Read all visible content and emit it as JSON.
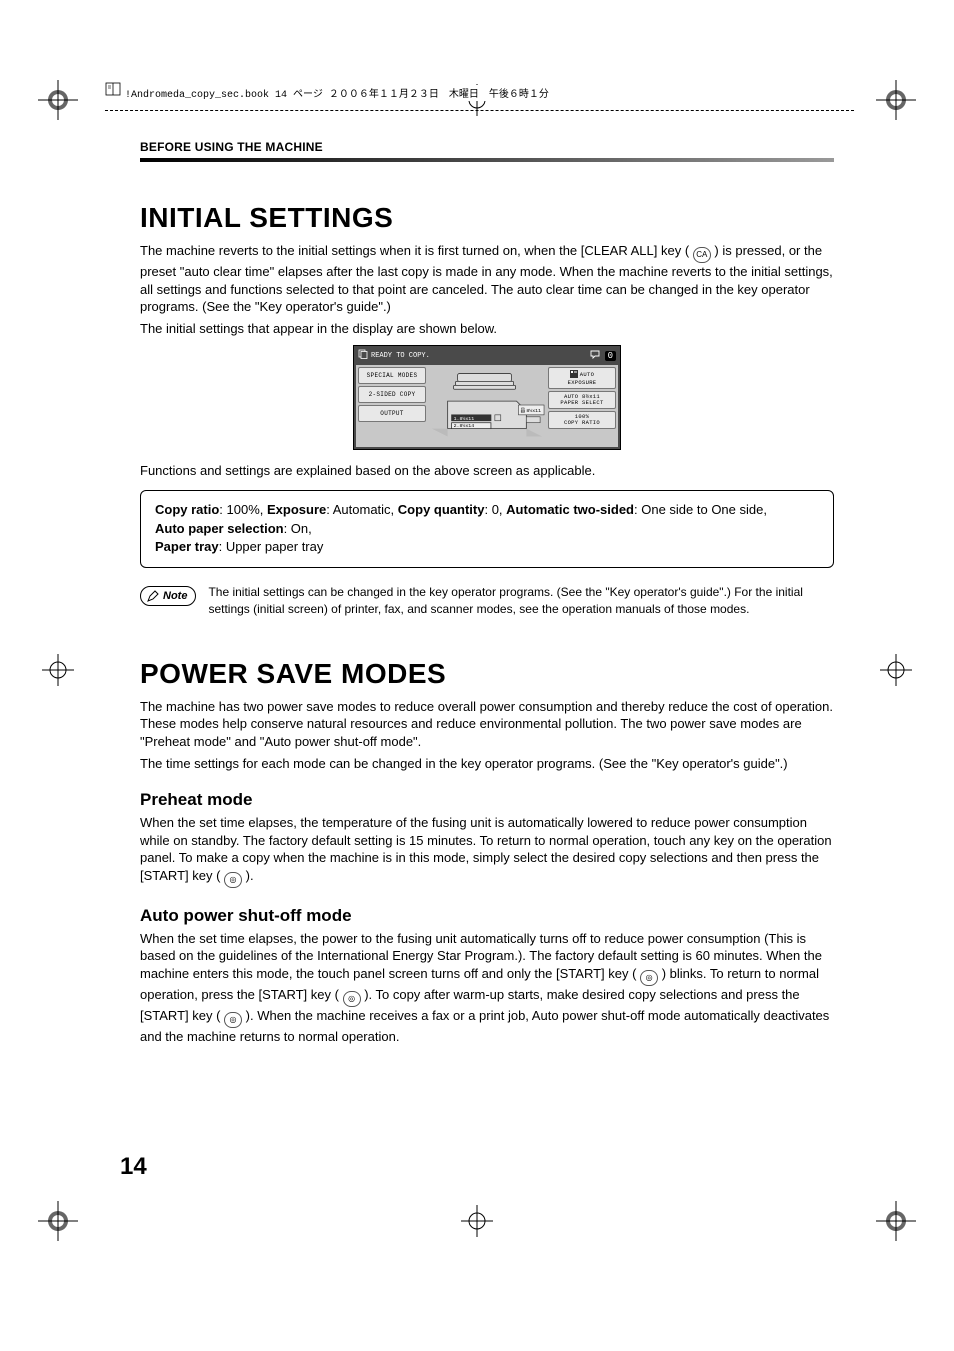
{
  "meta": {
    "header_line": "!Andromeda_copy_sec.book  14 ページ  ２００６年１１月２３日　木曜日　午後６時１分"
  },
  "page": {
    "section_header": "BEFORE USING THE MACHINE",
    "number": "14"
  },
  "initial": {
    "title": "INITIAL SETTINGS",
    "p1a": "The machine reverts to the initial settings when it is first turned on, when the [CLEAR ALL] key (",
    "p1_icon": "CA",
    "p1b": ") is pressed, or the preset \"auto clear time\" elapses after the last copy is made in any mode. When the machine reverts to the initial settings, all settings and functions selected to that point are canceled. The auto clear time can be changed in the key operator programs. (See the \"Key operator's guide\".)",
    "p2": "The initial settings that appear in the display are shown below.",
    "after_lcd": "Functions and settings are explained based on the above screen as applicable.",
    "box_l1a": "Copy ratio",
    "box_l1b": ": 100%, ",
    "box_l1c": "Exposure",
    "box_l1d": ": Automatic, ",
    "box_l1e": "Copy quantity",
    "box_l1f": ": 0, ",
    "box_l1g": "Automatic two-sided",
    "box_l1h": ": One side to One side,",
    "box_l2a": "Auto paper selection",
    "box_l2b": ": On,",
    "box_l3a": "Paper tray",
    "box_l3b": ": Upper paper tray",
    "note_label": "Note",
    "note_text": "The initial settings can be changed in the key operator programs. (See the \"Key operator's guide\".) For the initial settings (initial screen) of printer, fax, and scanner modes, see the operation manuals of those modes."
  },
  "lcd": {
    "ready": "READY TO COPY.",
    "counter": "0",
    "left": {
      "special": "SPECIAL MODES",
      "twosided": "2-SIDED COPY",
      "output": "OUTPUT"
    },
    "right": {
      "exposure_a": "AUTO",
      "exposure_b": "EXPOSURE",
      "paper_a": "AUTO   8½x11",
      "paper_b": "PAPER SELECT",
      "ratio_a": "100%",
      "ratio_b": "COPY RATIO"
    },
    "center": {
      "tray1": "1.8½x11",
      "tray2": "2.8½x14",
      "original": "8½x11"
    }
  },
  "power": {
    "title": "POWER SAVE MODES",
    "p1": "The machine has two power save modes to reduce overall power consumption and thereby reduce the cost of operation. These modes help conserve natural resources and reduce environmental pollution. The two power save modes are \"Preheat mode\" and \"Auto power shut-off mode\".",
    "p2": "The time settings for each mode can be changed in the key operator programs. (See the \"Key operator's guide\".)",
    "preheat_h": "Preheat mode",
    "preheat_p_a": "When the set time elapses, the temperature of the fusing unit is automatically lowered to reduce power consumption while on standby. The factory default setting is 15 minutes. To return to normal operation, touch any key on the operation panel. To make a copy when the machine is in this mode, simply select the desired copy selections and then press the [START] key (",
    "preheat_p_b": ").",
    "auto_h": "Auto power shut-off mode",
    "auto_p_a": "When the set time elapses, the power to the fusing unit automatically turns off to reduce power consumption (This is based on the guidelines of the International Energy Star Program.). The factory default setting is 60 minutes. When the machine enters this mode, the touch panel screen turns off and only the [START] key (",
    "auto_p_b": ") blinks. To return to normal operation, press the [START] key (",
    "auto_p_c": "). To copy after warm-up starts, make desired copy selections and press the [START] key (",
    "auto_p_d": "). When the machine receives a fax or a print job, Auto power shut-off mode automatically deactivates and the machine returns to normal operation."
  }
}
